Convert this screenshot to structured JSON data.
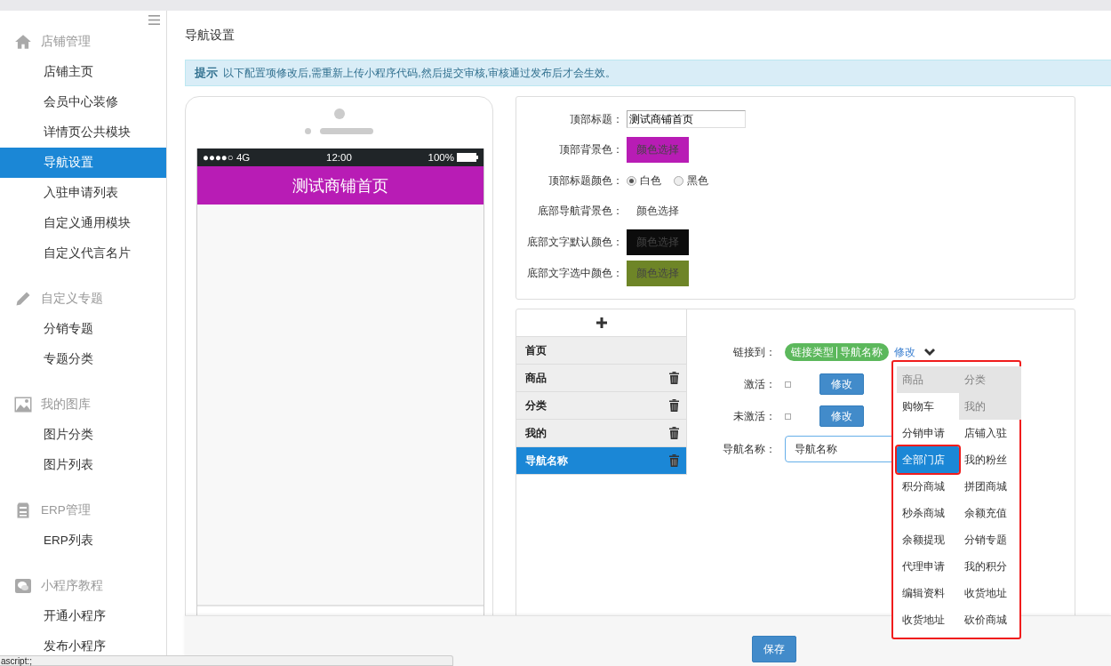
{
  "sidebar": {
    "groups": [
      {
        "title": "店铺管理",
        "items": [
          {
            "label": "店铺主页",
            "selected": false
          },
          {
            "label": "会员中心装修",
            "selected": false
          },
          {
            "label": "详情页公共模块",
            "selected": false
          },
          {
            "label": "导航设置",
            "selected": true
          },
          {
            "label": "入驻申请列表",
            "selected": false
          },
          {
            "label": "自定义通用模块",
            "selected": false
          },
          {
            "label": "自定义代言名片",
            "selected": false
          }
        ]
      },
      {
        "title": "自定义专题",
        "items": [
          {
            "label": "分销专题",
            "selected": false
          },
          {
            "label": "专题分类",
            "selected": false
          }
        ]
      },
      {
        "title": "我的图库",
        "items": [
          {
            "label": "图片分类",
            "selected": false
          },
          {
            "label": "图片列表",
            "selected": false
          }
        ]
      },
      {
        "title": "ERP管理",
        "items": [
          {
            "label": "ERP列表",
            "selected": false
          }
        ]
      },
      {
        "title": "小程序教程",
        "items": [
          {
            "label": "开通小程序",
            "selected": false
          },
          {
            "label": "发布小程序",
            "selected": false
          }
        ]
      }
    ]
  },
  "page_title": "导航设置",
  "notice": {
    "label": "提示",
    "text": "以下配置项修改后,需重新上传小程序代码,然后提交审核,审核通过发布后才会生效。"
  },
  "phone_preview": {
    "signal": "●●●●○",
    "network": "4G",
    "time": "12:00",
    "battery": "100%",
    "title": "测试商铺首页"
  },
  "settings": [
    {
      "kind": "text",
      "label": "顶部标题：",
      "value": "测试商铺首页"
    },
    {
      "kind": "color",
      "label": "顶部背景色：",
      "button": "颜色选择",
      "color": "#b81cb5"
    },
    {
      "kind": "radio",
      "label": "顶部标题颜色：",
      "options": [
        {
          "label": "白色",
          "selected": true
        },
        {
          "label": "黑色",
          "selected": false
        }
      ]
    },
    {
      "kind": "color",
      "label": "底部导航背景色：",
      "button": "颜色选择",
      "color": "#ffffff"
    },
    {
      "kind": "color",
      "label": "底部文字默认颜色：",
      "button": "颜色选择",
      "color": "#0c0c0c"
    },
    {
      "kind": "color",
      "label": "底部文字选中颜色：",
      "button": "颜色选择",
      "color": "#6e8527"
    }
  ],
  "nav_editor": {
    "items": [
      {
        "label": "首页",
        "deletable": false,
        "selected": false
      },
      {
        "label": "商品",
        "deletable": true,
        "selected": false
      },
      {
        "label": "分类",
        "deletable": true,
        "selected": false
      },
      {
        "label": "我的",
        "deletable": true,
        "selected": false
      },
      {
        "label": "导航名称",
        "deletable": true,
        "selected": true
      }
    ],
    "link": {
      "label": "链接到：",
      "tag_type": "链接类型",
      "tag_name": "导航名称",
      "edit": "修改"
    },
    "icon_rows": [
      {
        "label": "激活：",
        "button": "修改"
      },
      {
        "label": "未激活：",
        "button": "修改"
      }
    ],
    "name": {
      "label": "导航名称：",
      "value": "导航名称"
    }
  },
  "link_menu": {
    "items": [
      {
        "label": "商品",
        "disabled": true,
        "selected": false
      },
      {
        "label": "分类",
        "disabled": true,
        "selected": false
      },
      {
        "label": "购物车",
        "disabled": false,
        "selected": false
      },
      {
        "label": "我的",
        "disabled": true,
        "selected": false
      },
      {
        "label": "分销申请",
        "disabled": false,
        "selected": false
      },
      {
        "label": "店铺入驻",
        "disabled": false,
        "selected": false
      },
      {
        "label": "全部门店",
        "disabled": false,
        "selected": true
      },
      {
        "label": "我的粉丝",
        "disabled": false,
        "selected": false
      },
      {
        "label": "积分商城",
        "disabled": false,
        "selected": false
      },
      {
        "label": "拼团商城",
        "disabled": false,
        "selected": false
      },
      {
        "label": "秒杀商城",
        "disabled": false,
        "selected": false
      },
      {
        "label": "余额充值",
        "disabled": false,
        "selected": false
      },
      {
        "label": "余额提现",
        "disabled": false,
        "selected": false
      },
      {
        "label": "分销专题",
        "disabled": false,
        "selected": false
      },
      {
        "label": "代理申请",
        "disabled": false,
        "selected": false
      },
      {
        "label": "我的积分",
        "disabled": false,
        "selected": false
      },
      {
        "label": "编辑资料",
        "disabled": false,
        "selected": false
      },
      {
        "label": "收货地址",
        "disabled": false,
        "selected": false
      },
      {
        "label": "收货地址",
        "disabled": false,
        "selected": false
      },
      {
        "label": "砍价商城",
        "disabled": false,
        "selected": false
      }
    ]
  },
  "footer": {
    "save": "保存"
  },
  "status_tooltip": "ascript:;"
}
